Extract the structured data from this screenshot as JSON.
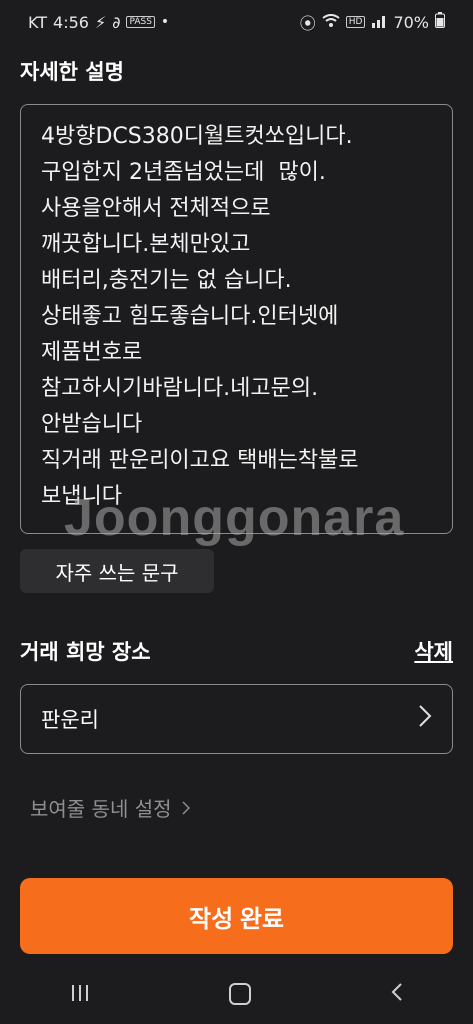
{
  "status_bar": {
    "carrier": "KT",
    "time": "4:56",
    "pass_badge": "PASS",
    "battery": "70%"
  },
  "description": {
    "title": "자세한 설명",
    "text": "4방향DCS380디월트컷쏘입니다.\n구입한지 2년좀넘었는데  많이.\n사용을안해서 전체적으로\n깨끗합니다.본체만있고\n배터리,충전기는 없 습니다.\n상태좋고 힘도좋습니다.인터넷에\n제품번호로\n참고하시기바람니다.네고문의.\n안받습니다\n직거래 판운리이고요 택배는착불로\n보냅니다",
    "watermark": "Joonggonara"
  },
  "phrase_button": "자주 쓰는 문구",
  "location": {
    "title": "거래 희망 장소",
    "delete_label": "삭제",
    "value": "판운리"
  },
  "neighborhood_link": "보여줄 동네 설정",
  "submit_label": "작성 완료",
  "colors": {
    "accent": "#f66d1c",
    "background": "#1c1c1e"
  }
}
